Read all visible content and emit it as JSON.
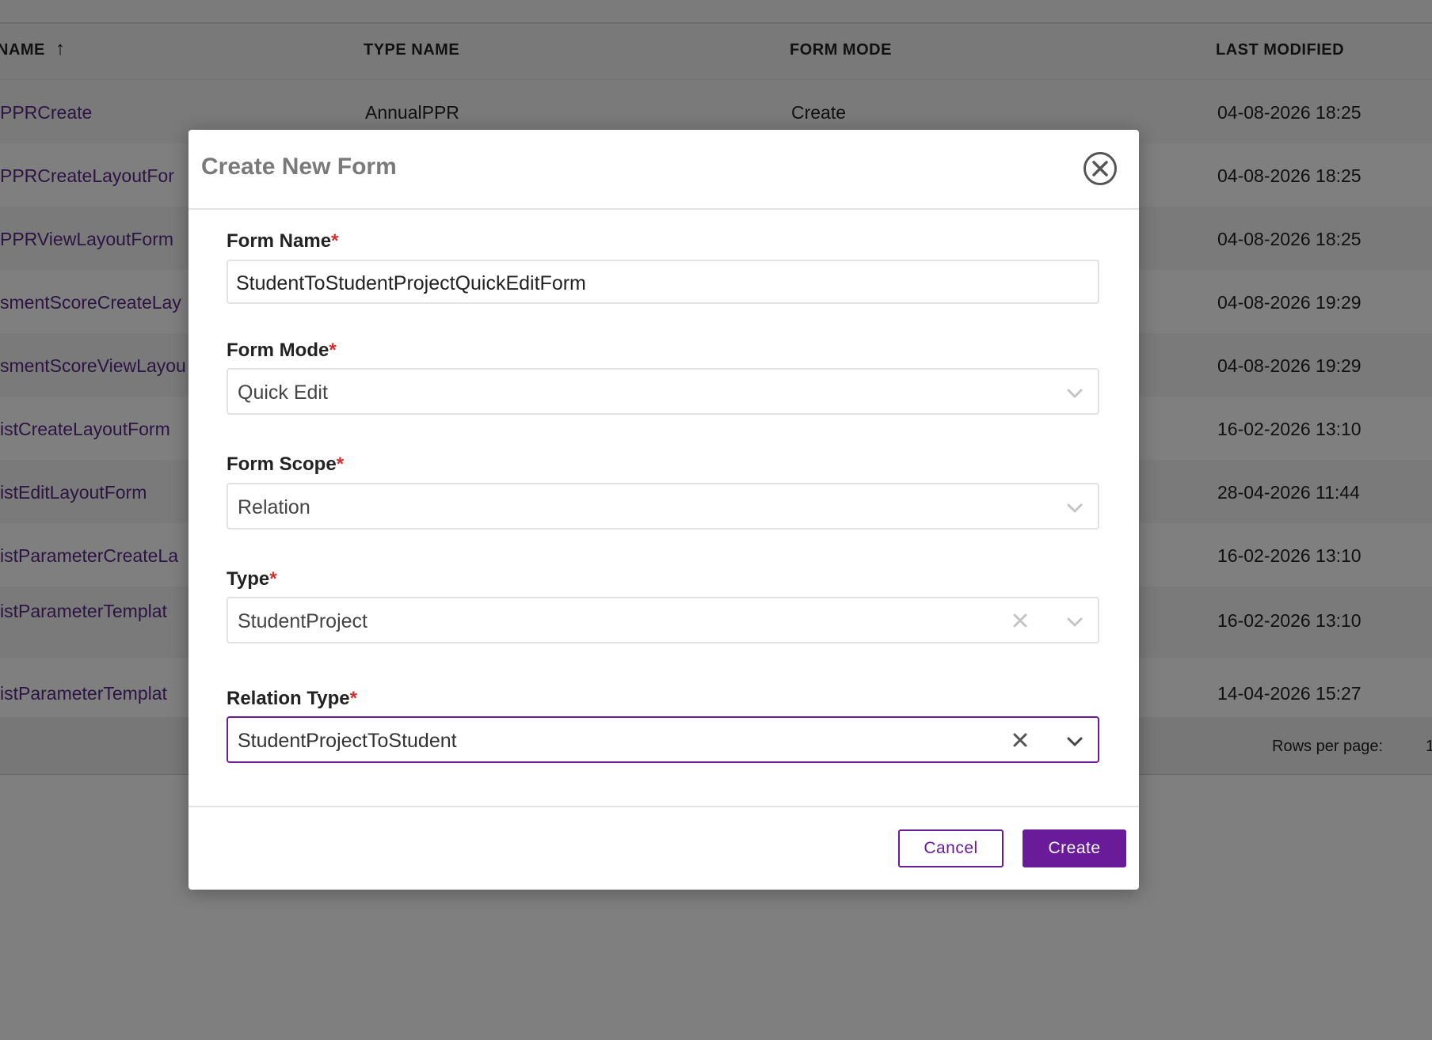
{
  "table": {
    "headers": {
      "name": "NAME",
      "type_name": "TYPE NAME",
      "form_mode": "FORM MODE",
      "last_modified": "LAST MODIFIED"
    },
    "rows": [
      {
        "name": "PPRCreate",
        "type_name": "AnnualPPR",
        "form_mode": "Create",
        "last_modified": "04-08-2026 18:25"
      },
      {
        "name": "PPRCreateLayoutFor",
        "type_name": "",
        "form_mode": "",
        "last_modified": "04-08-2026 18:25"
      },
      {
        "name": "PPRViewLayoutForm",
        "type_name": "",
        "form_mode": "",
        "last_modified": "04-08-2026 18:25"
      },
      {
        "name": "smentScoreCreateLay",
        "type_name": "",
        "form_mode": "",
        "last_modified": "04-08-2026 19:29"
      },
      {
        "name": "smentScoreViewLayou",
        "type_name": "",
        "form_mode": "",
        "last_modified": "04-08-2026 19:29"
      },
      {
        "name": "istCreateLayoutForm",
        "type_name": "",
        "form_mode": "",
        "last_modified": "16-02-2026 13:10"
      },
      {
        "name": "istEditLayoutForm",
        "type_name": "",
        "form_mode": "",
        "last_modified": "28-04-2026 11:44"
      },
      {
        "name": "istParameterCreateLa",
        "type_name": "",
        "form_mode": "",
        "last_modified": "16-02-2026 13:10"
      },
      {
        "name": "istParameterTemplat",
        "type_name": "",
        "form_mode": "",
        "last_modified": "16-02-2026 13:10"
      },
      {
        "name": "istParameterTemplat",
        "type_name": "",
        "form_mode": "",
        "last_modified": "14-04-2026 15:27"
      }
    ],
    "footer": {
      "rows_per_page_label": "Rows per page:",
      "rows_per_page_value": "1"
    }
  },
  "modal": {
    "title": "Create New Form",
    "fields": {
      "form_name": {
        "label": "Form Name",
        "required_mark": "*",
        "value": "StudentToStudentProjectQuickEditForm"
      },
      "form_mode": {
        "label": "Form Mode",
        "required_mark": "*",
        "value": "Quick Edit"
      },
      "form_scope": {
        "label": "Form Scope",
        "required_mark": "*",
        "value": "Relation"
      },
      "type": {
        "label": "Type",
        "required_mark": "*",
        "value": "StudentProject"
      },
      "relation_type": {
        "label": "Relation Type",
        "required_mark": "*",
        "value": "StudentProjectToStudent"
      }
    },
    "buttons": {
      "cancel": "Cancel",
      "create": "Create"
    }
  },
  "colors": {
    "accent": "#6a1b9a",
    "link": "#5b2a86",
    "required": "#d32f2f",
    "overlay": "rgba(0,0,0,0.5)"
  },
  "icons": {
    "sort": "arrow-up-icon",
    "close": "close-circle-icon",
    "dropdown": "chevron-down-icon",
    "clear": "x-icon"
  }
}
